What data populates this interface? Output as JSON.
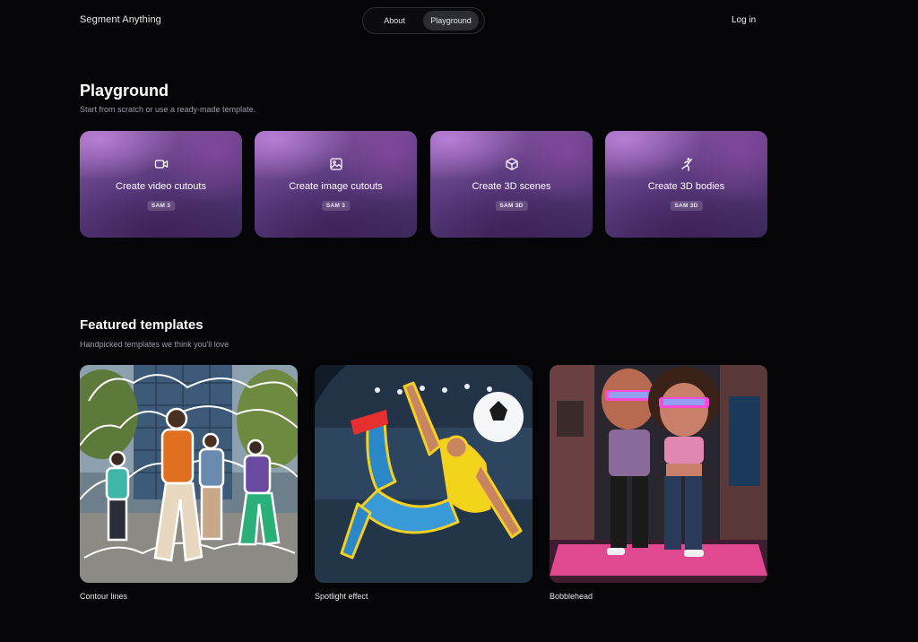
{
  "header": {
    "brand": "Segment Anything",
    "nav": [
      {
        "label": "About",
        "active": false
      },
      {
        "label": "Playground",
        "active": true
      }
    ],
    "login": "Log in"
  },
  "playground": {
    "title": "Playground",
    "subtitle": "Start from scratch or use a ready-made template.",
    "cards": [
      {
        "icon": "video-camera-icon",
        "label": "Create video cutouts",
        "badge": "SAM 3"
      },
      {
        "icon": "image-icon",
        "label": "Create image cutouts",
        "badge": "SAM 3"
      },
      {
        "icon": "cube-icon",
        "label": "Create 3D scenes",
        "badge": "SAM 3D"
      },
      {
        "icon": "dancing-person-icon",
        "label": "Create 3D bodies",
        "badge": "SAM 3D"
      }
    ]
  },
  "featured": {
    "title": "Featured templates",
    "subtitle": "Handpicked templates we think you'll love",
    "templates": [
      {
        "label": "Contour lines"
      },
      {
        "label": "Spotlight effect"
      },
      {
        "label": "Bobblehead"
      }
    ]
  },
  "colors": {
    "background": "#050508",
    "card_gradient": [
      "#8b5aa6",
      "#5a3a7e",
      "#3c2a5c"
    ],
    "spotlight_glow": "#f5d020",
    "contour_line": "#ffffff"
  }
}
